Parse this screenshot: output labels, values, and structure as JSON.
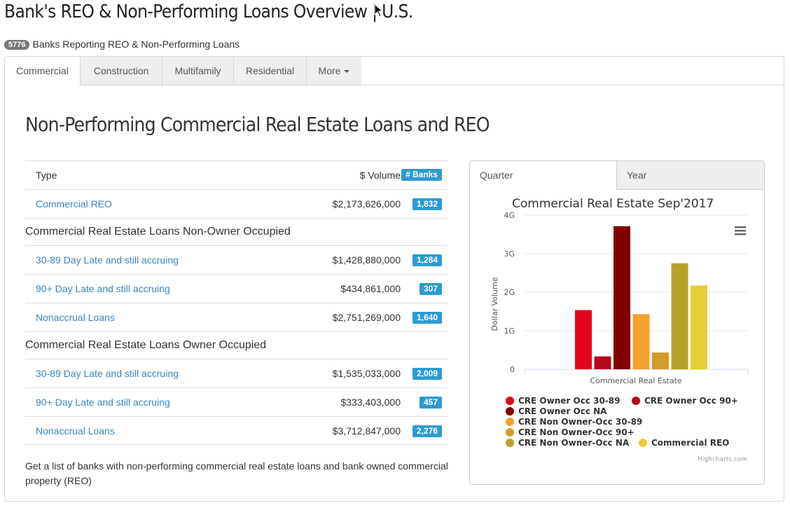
{
  "page": {
    "title": "Bank's REO & Non-Performing Loans Overview | U.S."
  },
  "summary": {
    "count": "5776",
    "label": "Banks Reporting REO & Non-Performing Loans"
  },
  "tabs": [
    {
      "label": "Commercial",
      "active": true
    },
    {
      "label": "Construction",
      "active": false
    },
    {
      "label": "Multifamily",
      "active": false
    },
    {
      "label": "Residential",
      "active": false
    },
    {
      "label": "More",
      "active": false
    }
  ],
  "section": {
    "title": "Non-Performing Commercial Real Estate Loans and REO"
  },
  "table": {
    "headers": {
      "type": "Type",
      "volume": "$ Volume",
      "banks": "# Banks"
    },
    "reo": {
      "label": "Commercial REO",
      "volume": "$2,173,626,000",
      "banks": "1,832"
    },
    "groups": [
      {
        "title": "Commercial Real Estate Loans Non-Owner Occupied",
        "rows": [
          {
            "label": "30-89 Day Late and still accruing",
            "volume": "$1,428,880,000",
            "banks": "1,284"
          },
          {
            "label": "90+ Day Late and still accruing",
            "volume": "$434,861,000",
            "banks": "307"
          },
          {
            "label": "Nonaccrual Loans",
            "volume": "$2,751,269,000",
            "banks": "1,640"
          }
        ]
      },
      {
        "title": "Commercial Real Estate Loans Owner Occupied",
        "rows": [
          {
            "label": "30-89 Day Late and still accruing",
            "volume": "$1,535,033,000",
            "banks": "2,009"
          },
          {
            "label": "90+ Day Late and still accruing",
            "volume": "$333,403,000",
            "banks": "457"
          },
          {
            "label": "Nonaccrual Loans",
            "volume": "$3,712,847,000",
            "banks": "2,276"
          }
        ]
      }
    ]
  },
  "footnote": "Get a list of banks with non-performing commercial real estate loans and bank owned commercial property (REO)",
  "chart_tabs": {
    "quarter": "Quarter",
    "year": "Year"
  },
  "chart_data": {
    "type": "bar",
    "title": "Commercial Real Estate Sep'2017",
    "xlabel": "Commercial Real Estate",
    "ylabel": "Dollar Volume",
    "yticks": [
      "0",
      "1G",
      "2G",
      "3G",
      "4G"
    ],
    "ylim": [
      0,
      4000000000
    ],
    "categories": [
      "Commercial Real Estate"
    ],
    "series": [
      {
        "name": "CRE Owner Occ 30-89",
        "values": [
          1535033000
        ],
        "color": "#e3051b"
      },
      {
        "name": "CRE Owner Occ 90+",
        "values": [
          333403000
        ],
        "color": "#b3081a"
      },
      {
        "name": "CRE Owner Occ NA",
        "values": [
          3712847000
        ],
        "color": "#800000"
      },
      {
        "name": "CRE Non Owner-Occ 30-89",
        "values": [
          1428880000
        ],
        "color": "#f5a12d"
      },
      {
        "name": "CRE Non Owner-Occ 90+",
        "values": [
          434861000
        ],
        "color": "#d49b28"
      },
      {
        "name": "CRE Non Owner-Occ NA",
        "values": [
          2751269000
        ],
        "color": "#b8a22a"
      },
      {
        "name": "Commercial REO",
        "values": [
          2173626000
        ],
        "color": "#e6cd36"
      }
    ],
    "legend_position": "bottom",
    "credits": "Highcharts.com",
    "grid": true
  }
}
